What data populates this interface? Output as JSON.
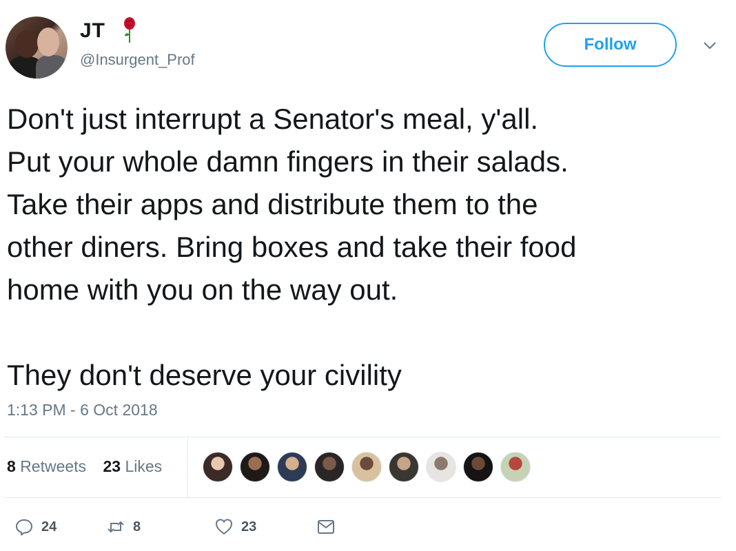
{
  "user": {
    "name": "JT",
    "handle": "@Insurgent_Prof"
  },
  "header": {
    "follow_label": "Follow"
  },
  "tweet": {
    "text": "Don't just interrupt a Senator's meal, y'all.\nPut your whole damn fingers in their salads.\nTake their apps and distribute them to the\nother diners. Bring boxes and take their food\nhome with you on the way out.\n\nThey don't deserve your civility",
    "timestamp": "1:13 PM - 6 Oct 2018"
  },
  "stats": {
    "retweets_count": "8",
    "retweets_label": "Retweets",
    "likes_count": "23",
    "likes_label": "Likes"
  },
  "likers": [
    {
      "color": "#3b2a25",
      "accent": "#e8c9b0"
    },
    {
      "color": "#1f1a18",
      "accent": "#9a6e55"
    },
    {
      "color": "#2e3b55",
      "accent": "#d4b08c"
    },
    {
      "color": "#2a2626",
      "accent": "#7c5a48"
    },
    {
      "color": "#d9c19e",
      "accent": "#6b4b3a"
    },
    {
      "color": "#3a3631",
      "accent": "#c6a487"
    },
    {
      "color": "#e7e4e2",
      "accent": "#8a7a70"
    },
    {
      "color": "#151313",
      "accent": "#6d4a36"
    },
    {
      "color": "#c6d2b4",
      "accent": "#b5483d"
    }
  ],
  "actions": {
    "replies": "24",
    "retweets": "8",
    "likes": "23"
  },
  "colors": {
    "accent": "#1da1f2",
    "muted": "#657786",
    "rose": "#c8102e"
  },
  "icons": [
    "rose-icon",
    "chevron-down-icon",
    "reply-icon",
    "retweet-icon",
    "heart-icon",
    "message-icon"
  ]
}
